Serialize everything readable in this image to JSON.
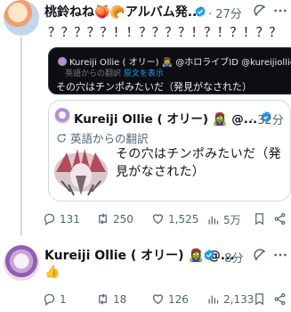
{
  "main_post": {
    "author_name": "桃鈴ねね🍑🥐アルバム発...",
    "time": "· 27分",
    "text": "？？？？？！！？？？？！？！？！？？",
    "screenshot": {
      "header": "Kureiji Ollie ( オリー) 🧟‍♀️ @ホロライブID  @kureijiollie",
      "translation_note": "英語からの翻訳",
      "translation_link": "原文を表示",
      "body": "その穴はチンポみたいだ（発見がなされた）"
    },
    "quote": {
      "author_name": "Kureiji Ollie ( オリー) 🧟‍♀️ @...",
      "time": "· 32分",
      "translation_note": "英語からの翻訳",
      "text": "その穴はチンポみたいだ（発見がなされた）"
    },
    "stats": {
      "replies": "131",
      "reposts": "250",
      "likes": "1,525",
      "views": "5万"
    }
  },
  "reply_post": {
    "author_name": "Kureiji Ollie ( オリー) 🧟‍♀️ @...",
    "time": "· 8分",
    "text": "👍",
    "stats": {
      "replies": "1",
      "reposts": "18",
      "likes": "126",
      "views": "2,133"
    }
  },
  "colors": {
    "verified": "#1d9bf0",
    "muted": "#536471",
    "border": "#cfd9de"
  }
}
